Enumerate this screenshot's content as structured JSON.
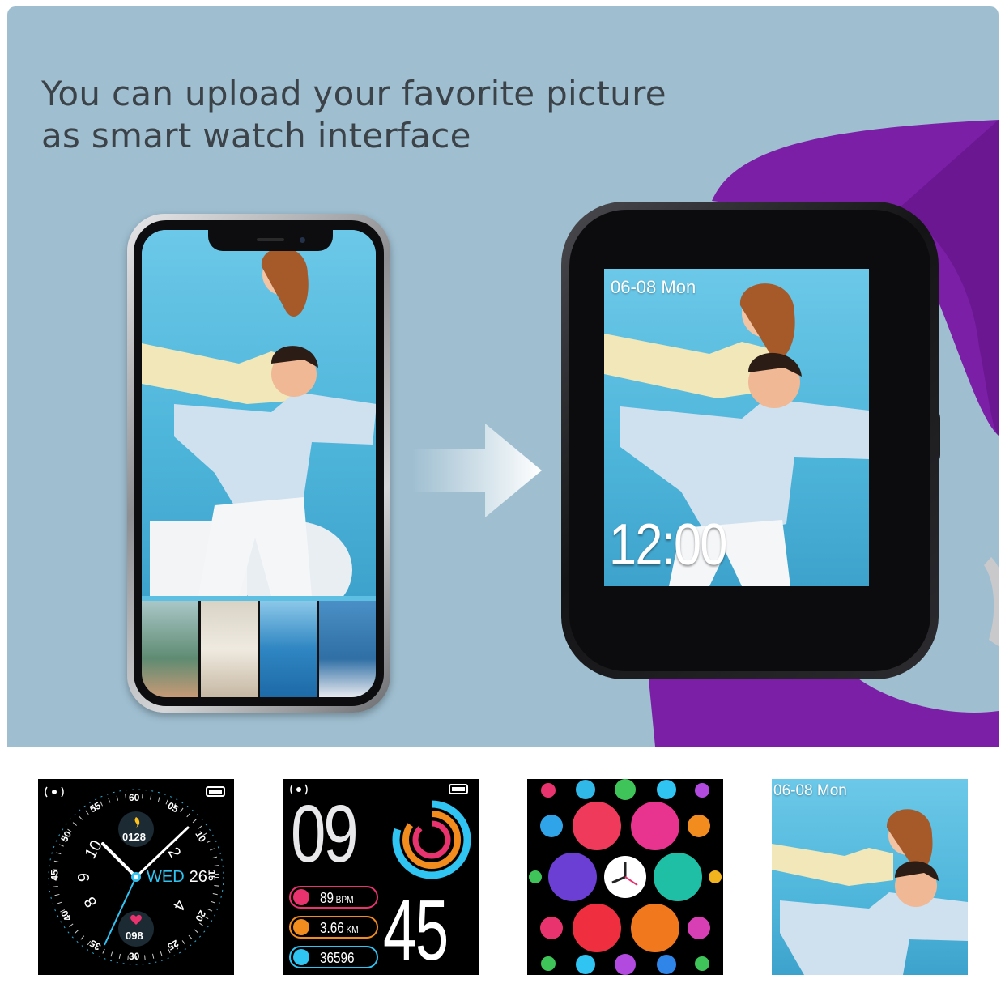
{
  "headline": {
    "line1": "You can upload your favorite picture",
    "line2": "as smart watch interface"
  },
  "watch": {
    "date": "06-08 Mon",
    "time": "12:00"
  },
  "faces": {
    "analog": {
      "center_steps": "0128",
      "heart": "098",
      "day": "WED",
      "date": "26",
      "dial": [
        "60",
        "05",
        "10",
        "15",
        "20",
        "25",
        "30",
        "35",
        "40",
        "45",
        "50",
        "55"
      ],
      "hours": [
        "10",
        "2",
        "9",
        "4",
        "8"
      ]
    },
    "digital": {
      "hour": "09",
      "minute": "45",
      "heart_value": "89",
      "heart_unit": "BPM",
      "distance_value": "3.66",
      "distance_unit": "KM",
      "steps_value": "36596"
    },
    "photo": {
      "date": "06-08 Mon"
    }
  },
  "colors": {
    "hero_bg": "#9fbfd1",
    "band": "#7a1fa6",
    "accent_cyan": "#2fc4f2"
  }
}
